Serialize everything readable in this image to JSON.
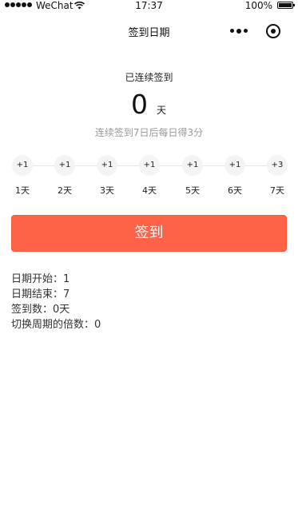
{
  "status_bar": {
    "carrier": "WeChat",
    "time": "17:37",
    "battery": "100%"
  },
  "nav": {
    "title": "签到日期"
  },
  "streak": {
    "label": "已连续签到",
    "count": "0",
    "unit": "天",
    "rule": "连续签到7日后每日得3分"
  },
  "days": [
    {
      "points": "+1",
      "label": "1天"
    },
    {
      "points": "+1",
      "label": "2天"
    },
    {
      "points": "+1",
      "label": "3天"
    },
    {
      "points": "+1",
      "label": "4天"
    },
    {
      "points": "+1",
      "label": "5天"
    },
    {
      "points": "+1",
      "label": "6天"
    },
    {
      "points": "+3",
      "label": "7天"
    }
  ],
  "checkin_button": {
    "label": "签到",
    "color": "#ff6347"
  },
  "info": {
    "start": "日期开始：1",
    "end": "日期结束：7",
    "count": "签到数：0天",
    "multiplier": "切换周期的倍数：0"
  }
}
